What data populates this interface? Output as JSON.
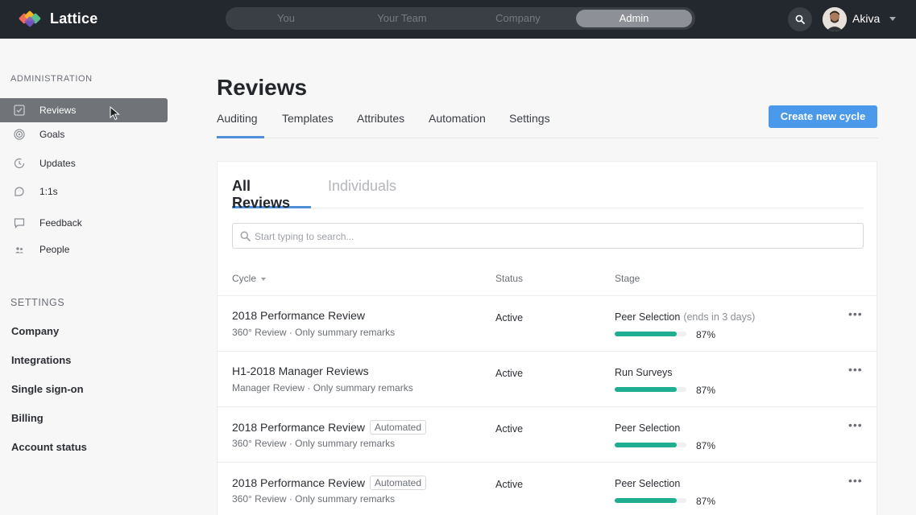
{
  "app": {
    "name": "Lattice"
  },
  "topnav": {
    "tabs": [
      "You",
      "Your Team",
      "Company",
      "Admin"
    ],
    "active_tab": "Admin",
    "user_name": "Akiva"
  },
  "sidebar": {
    "admin_heading": "ADMINISTRATION",
    "items": [
      {
        "label": "Reviews",
        "icon": "checklist-icon"
      },
      {
        "label": "Goals",
        "icon": "target-icon"
      },
      {
        "label": "Updates",
        "icon": "clock-icon"
      },
      {
        "label": "1:1s",
        "icon": "chat-bubble-icon"
      },
      {
        "label": "Feedback",
        "icon": "message-icon"
      },
      {
        "label": "People",
        "icon": "people-icon"
      }
    ],
    "active_item": "Reviews",
    "settings_heading": "SETTINGS",
    "settings_items": [
      "Company",
      "Integrations",
      "Single sign-on",
      "Billing",
      "Account status"
    ]
  },
  "page": {
    "title": "Reviews",
    "tabs": [
      "Auditing",
      "Templates",
      "Attributes",
      "Automation",
      "Settings"
    ],
    "active_tab": "Auditing",
    "create_button": "Create new cycle"
  },
  "card": {
    "subtabs": [
      "All Reviews",
      "Individuals"
    ],
    "active_subtab": "All Reviews",
    "search_placeholder": "Start typing to search...",
    "search_value": "",
    "columns": [
      "Cycle",
      "Status",
      "Stage"
    ],
    "rows": [
      {
        "title": "2018 Performance Review",
        "badge": "",
        "subtitle": "360° Review · Only summary remarks",
        "status": "Active",
        "stage": "Peer Selection",
        "stage_note": "(ends in 3 days)",
        "progress": 87,
        "progress_label": "87%"
      },
      {
        "title": "H1-2018 Manager Reviews",
        "badge": "",
        "subtitle": "Manager Review · Only summary remarks",
        "status": "Active",
        "stage": "Run Surveys",
        "stage_note": "",
        "progress": 87,
        "progress_label": "87%"
      },
      {
        "title": "2018 Performance Review",
        "badge": "Automated",
        "subtitle": "360° Review · Only summary remarks",
        "status": "Active",
        "stage": "Peer Selection",
        "stage_note": "",
        "progress": 87,
        "progress_label": "87%"
      },
      {
        "title": "2018 Performance Review",
        "badge": "Automated",
        "subtitle": "360° Review · Only summary remarks",
        "status": "Active",
        "stage": "Peer Selection",
        "stage_note": "",
        "progress": 87,
        "progress_label": "87%"
      }
    ],
    "row_menu": "•••"
  },
  "colors": {
    "topbar": "#23272e",
    "accent_blue": "#4a99ea",
    "progress_green": "#1fae8f",
    "logo": [
      "#f26a5a",
      "#f5b42b",
      "#5bbf8a",
      "#7a5bd1"
    ]
  }
}
